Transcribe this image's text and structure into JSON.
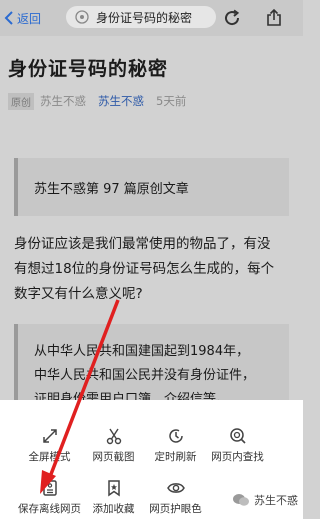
{
  "topbar": {
    "back_label": "返回",
    "url_text": "身份证号码的秘密"
  },
  "article": {
    "title": "身份证号码的秘密",
    "badge": "原创",
    "author_plain": "苏生不惑",
    "author_link": "苏生不惑",
    "time": "5天前",
    "quote1": "苏生不惑第 97 篇原创文章",
    "paragraph_lines": [
      "身份证应该是我们最常使用的物品了，有没",
      "有想过18位的身份证号码怎么生成的，每个",
      "数字又有什么意义呢?"
    ],
    "quote2_lines": [
      "从中华人民共和国建国起到1984年，",
      "中华人民共和国公民并没有身份证件，",
      "证明身份需用户口簿、介绍信等。"
    ]
  },
  "sheet": {
    "row1": [
      {
        "label": "全屏模式",
        "icon": "fullscreen-icon"
      },
      {
        "label": "网页截图",
        "icon": "scissors-icon"
      },
      {
        "label": "定时刷新",
        "icon": "clock-refresh-icon"
      },
      {
        "label": "网页内查找",
        "icon": "find-in-page-icon"
      }
    ],
    "row2": [
      {
        "label": "保存离线网页",
        "icon": "save-offline-icon"
      },
      {
        "label": "添加收藏",
        "icon": "bookmark-star-icon"
      },
      {
        "label": "网页护眼色",
        "icon": "eye-icon"
      }
    ]
  },
  "watermark": "苏生不惑",
  "colors": {
    "accent": "#2e5aa8",
    "annotation_arrow": "#e02020",
    "dim_overlay": "#d2d2d2",
    "sheet_bg": "#ffffff"
  }
}
